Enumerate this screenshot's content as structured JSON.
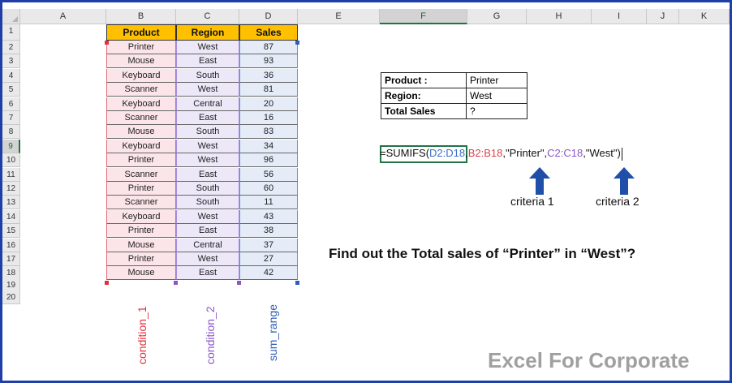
{
  "columns": [
    "A",
    "B",
    "C",
    "D",
    "E",
    "F",
    "G",
    "H",
    "I",
    "J",
    "K"
  ],
  "rows": [
    "1",
    "2",
    "3",
    "4",
    "5",
    "6",
    "7",
    "8",
    "9",
    "10",
    "11",
    "12",
    "13",
    "14",
    "15",
    "16",
    "17",
    "18",
    "19",
    "20"
  ],
  "table": {
    "headers": [
      "Product",
      "Region",
      "Sales"
    ],
    "rows": [
      [
        "Printer",
        "West",
        "87"
      ],
      [
        "Mouse",
        "East",
        "93"
      ],
      [
        "Keyboard",
        "South",
        "36"
      ],
      [
        "Scanner",
        "West",
        "81"
      ],
      [
        "Keyboard",
        "Central",
        "20"
      ],
      [
        "Scanner",
        "East",
        "16"
      ],
      [
        "Mouse",
        "South",
        "83"
      ],
      [
        "Keyboard",
        "West",
        "34"
      ],
      [
        "Printer",
        "West",
        "96"
      ],
      [
        "Scanner",
        "East",
        "56"
      ],
      [
        "Printer",
        "South",
        "60"
      ],
      [
        "Scanner",
        "South",
        "11"
      ],
      [
        "Keyboard",
        "West",
        "43"
      ],
      [
        "Printer",
        "East",
        "38"
      ],
      [
        "Mouse",
        "Central",
        "37"
      ],
      [
        "Printer",
        "West",
        "27"
      ],
      [
        "Mouse",
        "East",
        "42"
      ]
    ]
  },
  "info_table": [
    {
      "label": "Product :",
      "value": "Printer"
    },
    {
      "label": "Region:",
      "value": "West"
    },
    {
      "label": "Total Sales",
      "value": "?"
    }
  ],
  "formula": {
    "prefix": "=SUMIFS(",
    "sum_ref": "D2:D18",
    "sep1": ",",
    "crit1_ref": "B2:B18",
    "crit1_val": ",\"Printer\",",
    "crit2_ref": "C2:C18",
    "crit2_val": ",\"West\")"
  },
  "labels": {
    "criteria1": "criteria 1",
    "criteria2": "criteria 2",
    "question": "Find out the Total sales of “Printer” in “West”?",
    "condition1": "condition_1",
    "condition2": "condition_2",
    "sum_range": "sum_range",
    "brand": "Excel For Corporate"
  },
  "colors": {
    "header_fill": "#ffc000",
    "condition1": "#e0303f",
    "condition2": "#8a57c7",
    "sum_range": "#2f5db8",
    "arrow": "#1f4fa8",
    "frame": "#1f3fa6",
    "brand": "#a0a0a0"
  }
}
